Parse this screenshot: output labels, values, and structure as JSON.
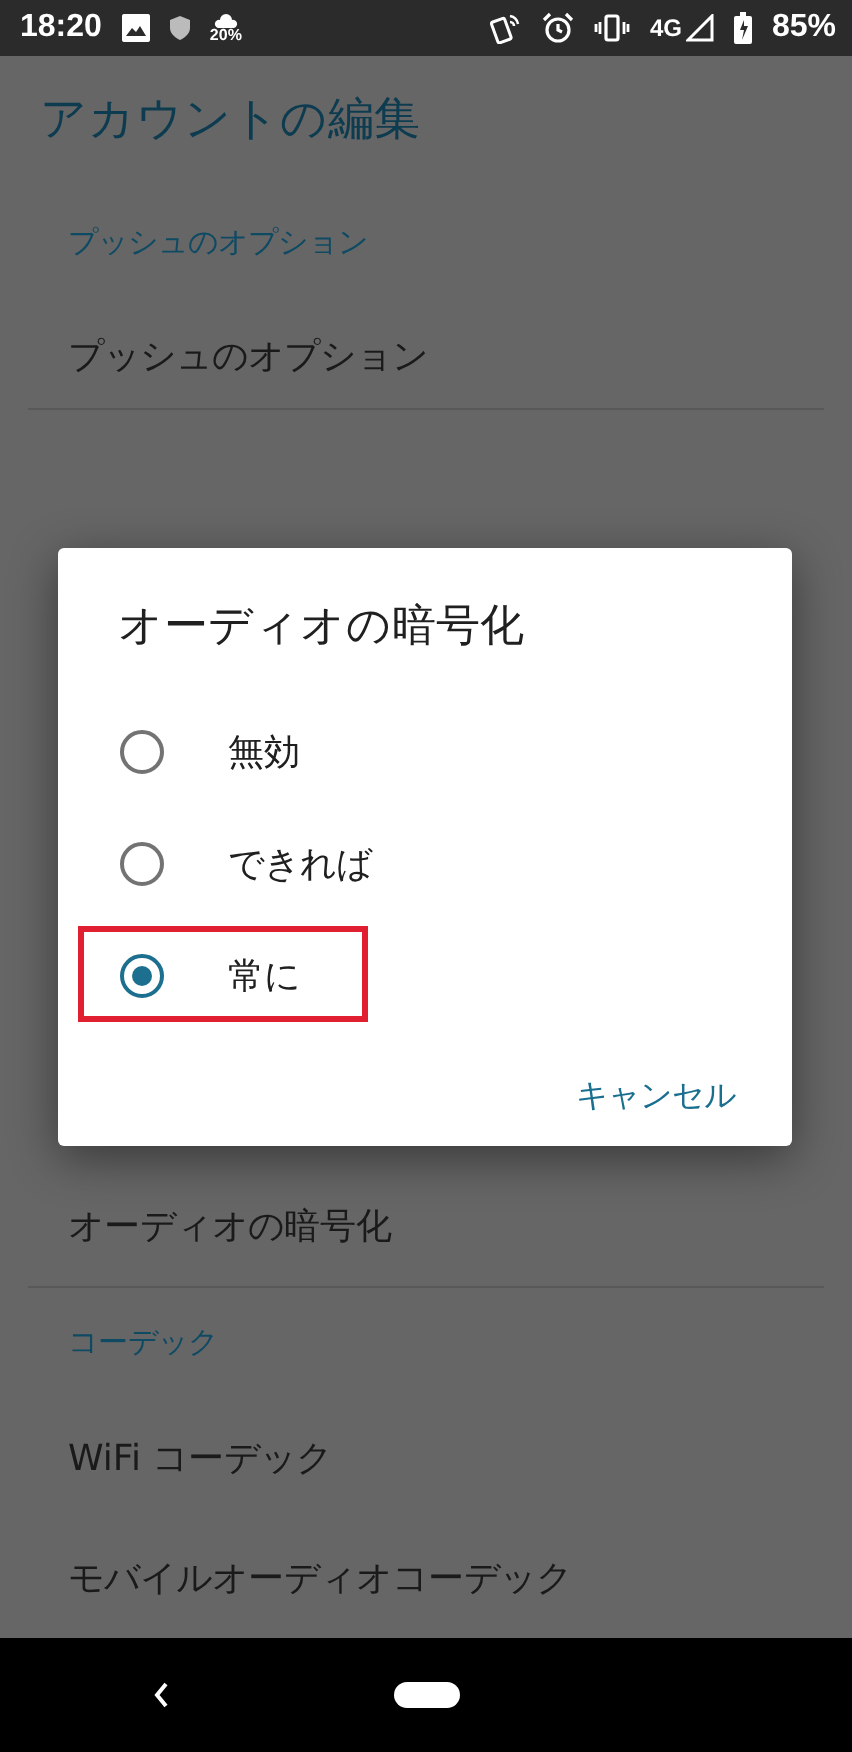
{
  "status_bar": {
    "time": "18:20",
    "weather": "20%",
    "network": "4G",
    "battery": "85%"
  },
  "title": "アカウントの編集",
  "sections_top": [
    {
      "header": "プッシュのオプション",
      "items": [
        "プッシュのオプション"
      ]
    }
  ],
  "sections_bottom": [
    {
      "items": [
        "オーディオの暗号化"
      ]
    },
    {
      "header": "コーデック",
      "items": [
        "WiFi コーデック",
        "モバイルオーディオコーデック"
      ]
    }
  ],
  "dialog": {
    "title": "オーディオの暗号化",
    "options": [
      {
        "label": "無効",
        "selected": false
      },
      {
        "label": "できれば",
        "selected": false
      },
      {
        "label": "常に",
        "selected": true
      }
    ],
    "buttons": [
      "キャンセル"
    ]
  }
}
